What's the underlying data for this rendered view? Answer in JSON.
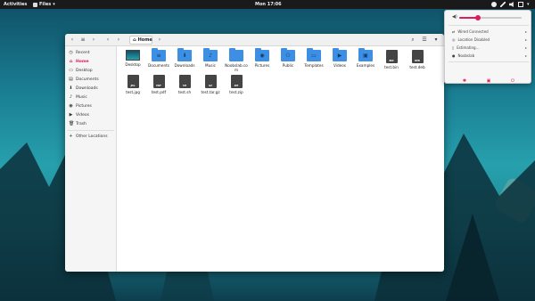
{
  "topbar": {
    "activities": "Activities",
    "app_menu": "Files",
    "clock": "Mon 17:06"
  },
  "window": {
    "headerbar": {
      "path_segment": "Home"
    },
    "sidebar": {
      "items": [
        {
          "label": "Recent",
          "icon": "clock-icon",
          "active": false
        },
        {
          "label": "Home",
          "icon": "home-icon",
          "active": true
        },
        {
          "label": "Desktop",
          "icon": "desktop-icon",
          "active": false
        },
        {
          "label": "Documents",
          "icon": "documents-icon",
          "active": false
        },
        {
          "label": "Downloads",
          "icon": "downloads-icon",
          "active": false
        },
        {
          "label": "Music",
          "icon": "music-icon",
          "active": false
        },
        {
          "label": "Pictures",
          "icon": "pictures-icon",
          "active": false
        },
        {
          "label": "Videos",
          "icon": "videos-icon",
          "active": false
        },
        {
          "label": "Trash",
          "icon": "trash-icon",
          "active": false
        }
      ],
      "other_locations": "Other Locations"
    },
    "files": [
      {
        "name": "Desktop",
        "kind": "desktop"
      },
      {
        "name": "Documents",
        "kind": "folder",
        "glyph": "≡"
      },
      {
        "name": "Downloads",
        "kind": "folder",
        "glyph": "⬇"
      },
      {
        "name": "Music",
        "kind": "folder",
        "glyph": "♪"
      },
      {
        "name": "Noobslab.com",
        "kind": "folder",
        "glyph": ""
      },
      {
        "name": "Pictures",
        "kind": "folder",
        "glyph": "◉"
      },
      {
        "name": "Public",
        "kind": "folder",
        "glyph": "⚇"
      },
      {
        "name": "Templates",
        "kind": "folder",
        "glyph": "▭"
      },
      {
        "name": "Videos",
        "kind": "folder",
        "glyph": "▶"
      },
      {
        "name": "Examples",
        "kind": "folder",
        "glyph": "▣"
      },
      {
        "name": "test.bin",
        "kind": "doc",
        "ext": "BIN"
      },
      {
        "name": "test.deb",
        "kind": "doc",
        "ext": "DEB"
      },
      {
        "name": "test.jpg",
        "kind": "doc",
        "ext": "JPG"
      },
      {
        "name": "test.pdf",
        "kind": "doc",
        "ext": "PDF"
      },
      {
        "name": "test.sh",
        "kind": "doc",
        "ext": "SH"
      },
      {
        "name": "test.tar.gz",
        "kind": "doc",
        "ext": "GZ"
      },
      {
        "name": "test.zip",
        "kind": "doc",
        "ext": "ZIP"
      }
    ]
  },
  "system_menu": {
    "volume_level": 0.3,
    "rows": [
      {
        "label": "Wired Connected",
        "icon": "network-icon"
      },
      {
        "label": "Location Disabled",
        "icon": "location-icon"
      },
      {
        "label": "Estimating…",
        "icon": "battery-icon"
      },
      {
        "label": "Noobslab",
        "icon": "user-icon"
      }
    ],
    "actions": [
      "settings-icon",
      "lock-icon",
      "power-icon"
    ]
  },
  "colors": {
    "accent": "#e01b5a",
    "folder": "#3d8fe3",
    "topbar": "#1a1a1a"
  }
}
